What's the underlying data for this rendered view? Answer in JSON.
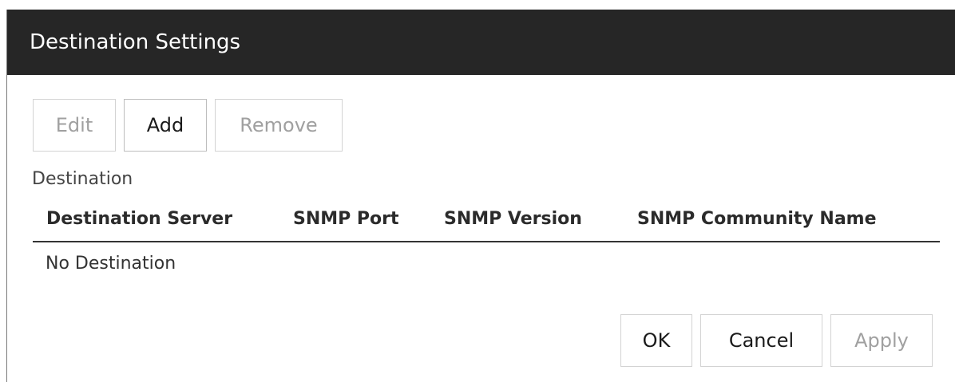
{
  "dialog": {
    "title": "Destination Settings"
  },
  "toolbar": {
    "edit_label": "Edit",
    "add_label": "Add",
    "remove_label": "Remove"
  },
  "destination": {
    "section_label": "Destination",
    "columns": [
      "Destination Server",
      "SNMP Port",
      "SNMP Version",
      "SNMP Community Name"
    ],
    "empty_text": "No Destination"
  },
  "footer": {
    "ok_label": "OK",
    "cancel_label": "Cancel",
    "apply_label": "Apply"
  }
}
